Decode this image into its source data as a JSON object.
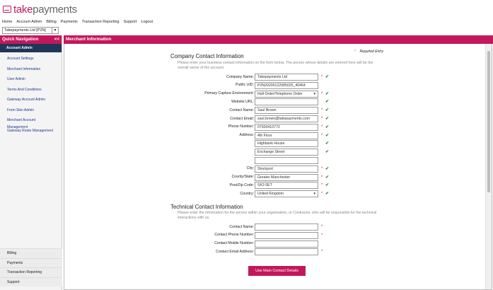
{
  "logo": {
    "brand_prefix": "take",
    "brand_suffix": "payments"
  },
  "nav": [
    "Home",
    "Account Admin",
    "Billing",
    "Payments",
    "Transaction Reporting",
    "Support",
    "Logout"
  ],
  "merchant_select": "Takepayments Ltd [P2N]",
  "sidebar": {
    "title": "Quick Navigation",
    "collapse": "<<",
    "active": "Account Admin",
    "links": [
      "Account Settings",
      "Merchant Information",
      "User Admin",
      "Terms And Conditions",
      "Gateway Account Admin",
      "Form Skin Admin",
      "Merchant Account Management",
      "Gateway Route Management"
    ],
    "bottom": [
      "Billing",
      "Payments",
      "Transaction Reporting",
      "Support"
    ]
  },
  "main_title": "Merchant Information",
  "required_note": "Required Entry",
  "company": {
    "title": "Company Contact Information",
    "desc": "Please enter your business contact information on the form below. The person whose details are entered here will be the overall owner of the account.",
    "fields": [
      {
        "label": "Company Name:",
        "value": "Takepayments Ltd",
        "req": true,
        "ok": true
      },
      {
        "label": "Public UID:",
        "value": "P2N20200122085025_40464",
        "req": false,
        "ok": false
      },
      {
        "label": "Primary Capture Environment:",
        "value": "Hall Order/Telephone Order",
        "req": true,
        "ok": true,
        "select": true
      },
      {
        "label": "Website URL:",
        "value": "",
        "req": false,
        "ok": true
      },
      {
        "label": "Contact Name:",
        "value": "Saul Brown",
        "req": true,
        "ok": true
      },
      {
        "label": "Contact Email:",
        "value": "saul.brown@takepayments.com",
        "req": true,
        "ok": true
      },
      {
        "label": "Phone Number:",
        "value": "07920410772",
        "req": true,
        "ok": true
      },
      {
        "label": "Address:",
        "value": "4th Floor",
        "req": true,
        "ok": true
      },
      {
        "label": "",
        "value": "Highbank House",
        "req": false,
        "ok": true
      },
      {
        "label": "",
        "value": "Exchange Street",
        "req": false,
        "ok": true
      },
      {
        "label": "",
        "value": "",
        "req": false,
        "ok": false
      },
      {
        "label": "City:",
        "value": "Stockport",
        "req": true,
        "ok": true
      },
      {
        "label": "County/State:",
        "value": "Greater Manchester",
        "req": true,
        "ok": true
      },
      {
        "label": "Post/Zip Code:",
        "value": "SK3 0ET",
        "req": true,
        "ok": true
      },
      {
        "label": "Country:",
        "value": "United Kingdom",
        "req": true,
        "ok": true,
        "select": true
      }
    ]
  },
  "technical": {
    "title": "Technical Contact Information",
    "desc": "Please enter the information for the person within your organisation, or Contractor, who will be responsible for the technical interactions with us.",
    "fields": [
      {
        "label": "Contact Name:",
        "value": "",
        "req": true
      },
      {
        "label": "Contact Phone Number:",
        "value": "",
        "req": true
      },
      {
        "label": "Contact Mobile Number:",
        "value": "",
        "req": false
      },
      {
        "label": "Contact Email Address:",
        "value": "",
        "req": true
      }
    ]
  },
  "button": "Use Main Contact Details",
  "glyphs": {
    "star": "*",
    "tick": "✔",
    "dropdown": "▼"
  }
}
